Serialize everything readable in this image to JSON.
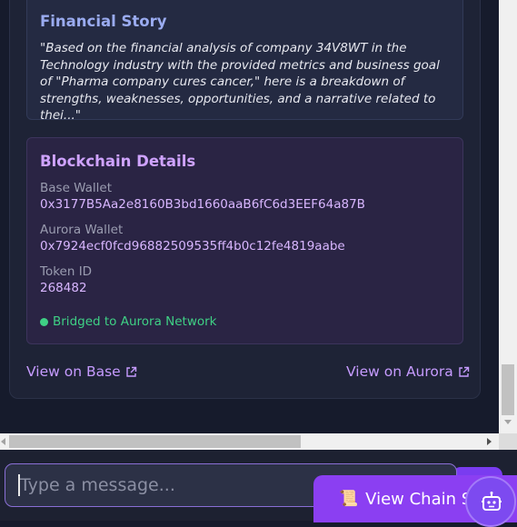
{
  "financial_story": {
    "title": "Financial Story",
    "text": "\"Based on the financial analysis of company 34V8WT in the Technology industry with the provided metrics and business goal of \"Pharma company cures cancer,\" here is a breakdown of strengths, weaknesses, opportunities, and a narrative related to thei...\""
  },
  "blockchain": {
    "title": "Blockchain Details",
    "base_wallet_label": "Base Wallet",
    "base_wallet": "0x3177B5Aa2e8160B3bd1660aaB6fC6d3EEF64a87B",
    "aurora_wallet_label": "Aurora Wallet",
    "aurora_wallet": "0x7924ecf0fcd96882509535ff4b0c12fe4819aabe",
    "token_label": "Token ID",
    "token_id": "268482",
    "bridge_status": "Bridged to Aurora Network"
  },
  "links": {
    "view_base": "View on Base",
    "view_aurora": "View on Aurora"
  },
  "chat": {
    "placeholder": "Type a message...",
    "chain_button": "View Chain St"
  },
  "colors": {
    "accent": "#8b3ff2",
    "success": "#3fd085",
    "link": "#c69bff"
  }
}
